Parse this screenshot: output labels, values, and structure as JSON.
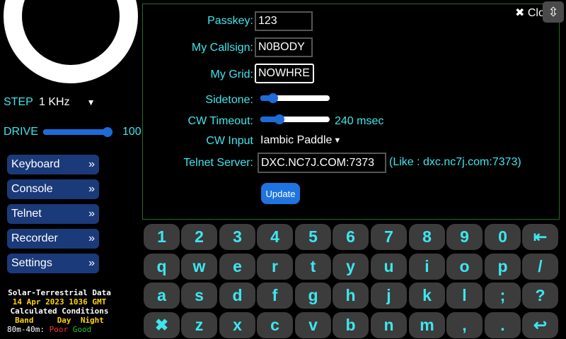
{
  "left": {
    "step_label": "STEP",
    "step_value": "1 KHz",
    "drive_label": "DRIVE",
    "drive_value": "100",
    "drive_level": 1.0,
    "menu": [
      "Keyboard",
      "Console",
      "Telnet",
      "Recorder",
      "Settings"
    ],
    "menu_chevron": "»",
    "solar": {
      "title": "Solar-Terrestrial Data",
      "date": "14 Apr 2023 1036 GMT",
      "subtitle": "Calculated Conditions",
      "col_band": "Band",
      "col_day": "Day",
      "col_night": "Night",
      "row_band": "80m-40m:",
      "row_day": "Poor",
      "row_night": "Good"
    }
  },
  "settings": {
    "close_label": "✖ Clo",
    "passkey_label": "Passkey:",
    "passkey_value": "123",
    "callsign_label": "My Callsign:",
    "callsign_value": "N0BODY",
    "grid_label": "My Grid:",
    "grid_value": "NOWHRE",
    "sidetone_label": "Sidetone:",
    "sidetone_level": 0.18,
    "cw_timeout_label": "CW Timeout:",
    "cw_timeout_level": 0.28,
    "cw_timeout_value": "240 msec",
    "cw_input_label": "CW Input",
    "cw_input_value": "Iambic Paddle",
    "telnet_label": "Telnet Server:",
    "telnet_value": "DXC.NC7J.COM:7373",
    "telnet_hint": "(Like : dxc.nc7j.com:7373)",
    "update_label": "Update"
  },
  "expand_icon": "⇳",
  "keyboard": {
    "rows": [
      [
        "1",
        "2",
        "3",
        "4",
        "5",
        "6",
        "7",
        "8",
        "9",
        "0",
        "⇤"
      ],
      [
        "q",
        "w",
        "e",
        "r",
        "t",
        "y",
        "u",
        "i",
        "o",
        "p",
        "/"
      ],
      [
        "a",
        "s",
        "d",
        "f",
        "g",
        "h",
        "j",
        "k",
        "l",
        ";",
        "?"
      ],
      [
        "✖",
        "z",
        "x",
        "c",
        "v",
        "b",
        "n",
        "m",
        ",",
        ".",
        "↩"
      ]
    ]
  }
}
